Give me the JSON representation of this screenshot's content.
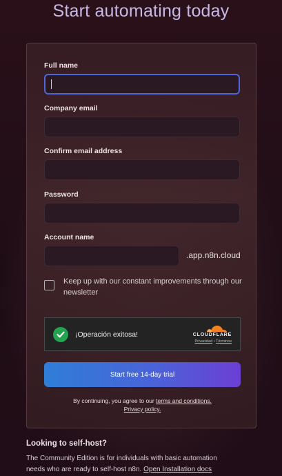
{
  "page": {
    "title": "Start automating today"
  },
  "form": {
    "full_name": {
      "label": "Full name",
      "value": ""
    },
    "company_email": {
      "label": "Company email",
      "value": ""
    },
    "confirm_email": {
      "label": "Confirm email address",
      "value": ""
    },
    "password": {
      "label": "Password",
      "value": ""
    },
    "account_name": {
      "label": "Account name",
      "value": "",
      "suffix": ".app.n8n.cloud"
    },
    "newsletter": {
      "label": "Keep up with our constant improvements through our newsletter",
      "checked": false
    }
  },
  "captcha": {
    "status": "¡Operación exitosa!",
    "brand": "CLOUDFLARE",
    "privacy_link": "Privacidad",
    "separator": "•",
    "terms_link": "Términos",
    "success_color": "#23a451",
    "logo_color": "#f48120"
  },
  "cta": {
    "label": "Start free 14-day trial"
  },
  "legal": {
    "prefix": "By continuing, you agree to our",
    "terms_link": "terms and conditions.",
    "privacy_link": "Privacy policy."
  },
  "selfhost": {
    "title": "Looking to self-host?",
    "text": "The Community Edition is for individuals with basic automation needs who are ready to self-host n8n.",
    "link": "Open Installation docs"
  },
  "colors": {
    "title": "#c8b8e8",
    "focus_border": "#4e66d8",
    "cta_gradient_start": "#2f7ed8",
    "cta_gradient_end": "#6b3fd4"
  }
}
